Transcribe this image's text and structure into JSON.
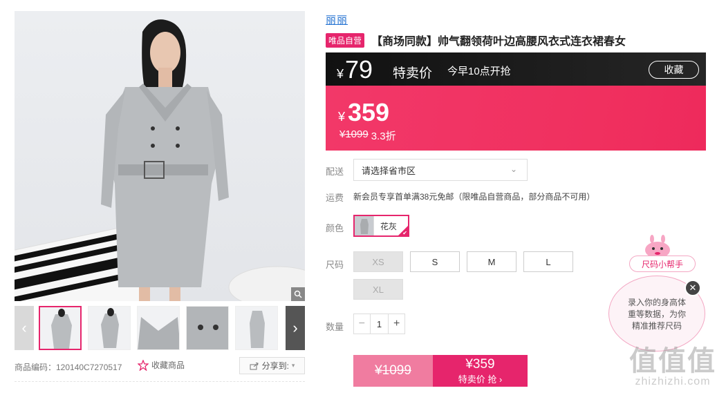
{
  "product": {
    "brand": "丽丽",
    "badge": "唯品自营",
    "title": "【商场同款】帅气翻领荷叶边高腰风衣式连衣裙春女"
  },
  "flash": {
    "currency": "¥",
    "price": "79",
    "label": "特卖价",
    "time": "今早10点开抢",
    "collect": "收藏"
  },
  "price": {
    "currency": "¥",
    "sale": "359",
    "original": "¥1099",
    "discount": "3.3折"
  },
  "delivery": {
    "label": "配送",
    "placeholder": "请选择省市区"
  },
  "freight": {
    "label": "运费",
    "text": "新会员专享首单满38元免邮（限唯品自营商品，部分商品不可用）"
  },
  "color": {
    "label": "颜色",
    "selected": "花灰"
  },
  "size": {
    "label": "尺码",
    "options": [
      "XS",
      "S",
      "M",
      "L",
      "XL"
    ]
  },
  "quantity": {
    "label": "数量",
    "value": "1",
    "minus": "−",
    "plus": "+"
  },
  "buy": {
    "original": "¥1099",
    "price": "¥359",
    "sub": "特卖价 抢 ›"
  },
  "gallery": {
    "product_code": "商品编码：120140C7270517",
    "favorite": "收藏商品",
    "share": "分享到:"
  },
  "helper": {
    "tag": "尺码小帮手",
    "bubble_line1": "录入你的身高体",
    "bubble_line2": "重等数据，为你",
    "bubble_line3": "精准推荐尺码"
  },
  "watermark": {
    "logo": "值值值",
    "url": "zhizhizhi.com"
  },
  "colors": {
    "accent": "#e6256c",
    "flash_bar": "#1a1a1a",
    "price_bar": "#f0305f",
    "brand_link": "#1f6fd0"
  }
}
